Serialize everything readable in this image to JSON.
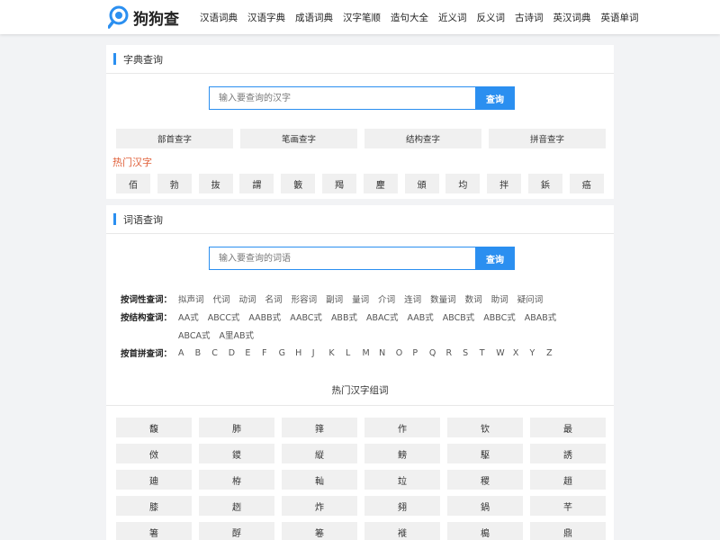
{
  "logo": {
    "text": "狗狗查"
  },
  "nav": [
    "汉语词典",
    "汉语字典",
    "成语词典",
    "汉字笔顺",
    "造句大全",
    "近义词",
    "反义词",
    "古诗词",
    "英汉词典",
    "英语单词"
  ],
  "zidian": {
    "title": "字典查询",
    "placeholder": "输入要查询的汉字",
    "button": "查询",
    "modes": [
      "部首查字",
      "笔画查字",
      "结构查字",
      "拼音查字"
    ],
    "hot_title": "热门汉字",
    "hot_chars": [
      "佰",
      "勃",
      "抜",
      "謂",
      "籔",
      "羯",
      "麈",
      "頒",
      "均",
      "拌",
      "鋲",
      "癌"
    ]
  },
  "ciyu": {
    "title": "词语查询",
    "placeholder": "输入要查询的词语",
    "button": "查询",
    "by_pos_label": "按词性查词：",
    "by_pos": [
      "拟声词",
      "代词",
      "动词",
      "名词",
      "形容词",
      "副词",
      "量词",
      "介词",
      "连词",
      "数量词",
      "数词",
      "助词",
      "疑问词"
    ],
    "by_struct_label": "按结构查词：",
    "by_struct_row1": [
      "AA式",
      "ABCC式",
      "AABB式",
      "AABC式",
      "ABB式",
      "ABAC式",
      "AAB式",
      "ABCB式",
      "ABBC式",
      "ABAB式"
    ],
    "by_struct_row2": [
      "ABCA式",
      "A里AB式"
    ],
    "by_pinyin_label": "按首拼查词：",
    "letters": [
      "A",
      "B",
      "C",
      "D",
      "E",
      "F",
      "G",
      "H",
      "J",
      "K",
      "L",
      "M",
      "N",
      "O",
      "P",
      "Q",
      "R",
      "S",
      "T",
      "W",
      "X",
      "Y",
      "Z"
    ],
    "grid_title": "热门汉字组词",
    "grid_chars": [
      "馥",
      "肺",
      "箨",
      "作",
      "钦",
      "最",
      "傚",
      "鑁",
      "縦",
      "鳑",
      "駆",
      "誘",
      "廸",
      "栫",
      "軕",
      "竝",
      "稷",
      "趙",
      "膝",
      "趔",
      "炸",
      "翗",
      "鍋",
      "芊",
      "箸",
      "酻",
      "箞",
      "褷",
      "槝",
      "鼎"
    ]
  },
  "colors": {
    "accent": "#2b8ff0",
    "hot": "#e0603a"
  }
}
